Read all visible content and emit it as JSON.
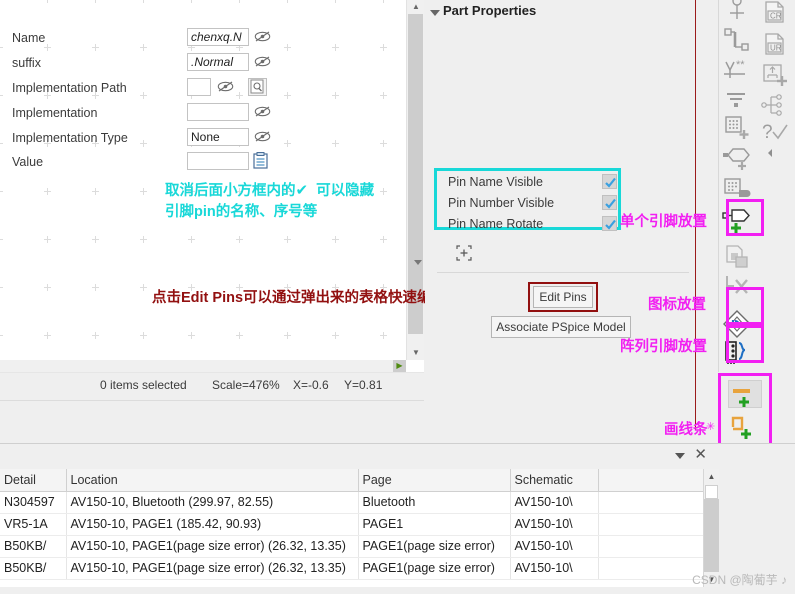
{
  "canvas": {
    "annotation_cyan_line1": "取消后面小方框内的",
    "annotation_cyan_check": "✔",
    "annotation_cyan_line1b": "可以隐藏",
    "annotation_cyan_line2": "引脚pin的名称、序号等",
    "annotation_darkred": "点击Edit Pins可以通过弹出来的表格快速编辑各引脚",
    "scroll_up_icon": "scroll-up-icon",
    "scroll_down_icon": "scroll-down-icon",
    "scroll_right_icon": "scroll-right-icon"
  },
  "statusbar": {
    "items_selected": "0 items selected",
    "scale": "Scale=476%",
    "x": "X=-0.6",
    "y": "Y=0.81"
  },
  "properties": {
    "title": "Part Properties",
    "rows": [
      {
        "label": "Name",
        "value": "chenxq.N",
        "placeholder": "",
        "italic": true,
        "has_eye": true,
        "has_browse": false,
        "has_clip": false,
        "type": "text"
      },
      {
        "label": "suffix",
        "value": ".Normal",
        "placeholder": "",
        "italic": true,
        "has_eye": true,
        "has_browse": false,
        "has_clip": false,
        "type": "text"
      },
      {
        "label": "Implementation Path",
        "value": "",
        "placeholder": "",
        "italic": false,
        "has_eye": true,
        "has_browse": true,
        "has_clip": false,
        "type": "text"
      },
      {
        "label": "Implementation",
        "value": "",
        "placeholder": "",
        "italic": false,
        "has_eye": true,
        "has_browse": false,
        "has_clip": false,
        "type": "text"
      },
      {
        "label": "Implementation Type",
        "value": "None",
        "placeholder": "",
        "italic": false,
        "has_eye": true,
        "has_browse": false,
        "has_clip": false,
        "type": "select"
      },
      {
        "label": "Value",
        "value": "",
        "placeholder": "",
        "italic": false,
        "has_eye": false,
        "has_browse": false,
        "has_clip": true,
        "type": "text"
      }
    ],
    "checkboxes": [
      {
        "label": "Pin Name Visible",
        "checked": true
      },
      {
        "label": "Pin Number Visible",
        "checked": true
      },
      {
        "label": "Pin Name Rotate",
        "checked": true
      }
    ],
    "edit_pins_label": "Edit Pins",
    "associate_pspice_label": "Associate PSpice Model",
    "expand_icon": "expand-marker-icon"
  },
  "annotations_magenta": {
    "single_pin": "单个引脚放置",
    "icon_place": "图标放置",
    "array_pin": "阵列引脚放置",
    "draw_line": "画线条"
  },
  "toolbar_main": [
    {
      "name": "place-net-alias-icon",
      "highlighted": false
    },
    {
      "name": "place-bus-entry-icon",
      "highlighted": false
    },
    {
      "name": "place-power-icon",
      "highlighted": false
    },
    {
      "name": "place-ground-icon",
      "highlighted": false
    },
    {
      "name": "place-hier-block-icon",
      "highlighted": false
    },
    {
      "name": "place-hier-port-icon",
      "highlighted": false
    },
    {
      "name": "place-hier-pin-icon",
      "highlighted": false
    },
    {
      "name": "place-pin-icon",
      "highlighted": true
    },
    {
      "name": "place-off-page-connector-icon",
      "highlighted": false
    },
    {
      "name": "place-no-connect-icon",
      "highlighted": false
    },
    {
      "name": "place-ieee-symbol-icon",
      "highlighted": true
    },
    {
      "name": "place-pin-array-icon",
      "highlighted": true
    }
  ],
  "toolbar_secondary": [
    {
      "name": "create-cr-doc-icon",
      "label": "CR"
    },
    {
      "name": "create-ur-doc-icon",
      "label": "UR"
    },
    {
      "name": "add-part-icon",
      "label": ""
    },
    {
      "name": "hierarchy-tree-icon",
      "label": ""
    },
    {
      "name": "help-check-icon",
      "label": "?"
    },
    {
      "name": "collapse-arrow-icon",
      "label": ""
    }
  ],
  "toolbar_draw": [
    {
      "name": "draw-line-icon"
    },
    {
      "name": "draw-polyline-icon"
    },
    {
      "name": "draw-rectangle-icon"
    },
    {
      "name": "draw-ellipse-icon"
    },
    {
      "name": "draw-arc-icon"
    },
    {
      "name": "draw-bezier-icon"
    }
  ],
  "bottom_panel": {
    "dropdown_icon": "panel-menu-caret-icon",
    "close_label": "✕",
    "columns": [
      "Detail",
      "Location",
      "Page",
      "Schematic",
      ""
    ],
    "rows": [
      {
        "detail": "N304597",
        "location": "AV150-10, Bluetooth  (299.97, 82.55)",
        "page": "Bluetooth",
        "schematic": "AV150-10\\",
        "extra": ""
      },
      {
        "detail": "VR5-1A",
        "location": "AV150-10, PAGE1  (185.42, 90.93)",
        "page": "PAGE1",
        "schematic": "AV150-10\\",
        "extra": ""
      },
      {
        "detail": "B50KB/",
        "location": "AV150-10, PAGE1(page size error)  (26.32, 13.35)",
        "page": "PAGE1(page size error)",
        "schematic": "AV150-10\\",
        "extra": ""
      },
      {
        "detail": "B50KB/",
        "location": "AV150-10, PAGE1(page size error)  (26.32, 13.35)",
        "page": "PAGE1(page size error)",
        "schematic": "AV150-10\\",
        "extra": ""
      }
    ],
    "scroll_up_icon": "scroll-up-icon",
    "scroll_down_icon": "scroll-down-icon"
  },
  "watermark": "CSDN @陶葡芋 ♪",
  "colors": {
    "cyan": "#18d8d8",
    "magenta": "#f21ff2",
    "darkred": "#921010",
    "orange": "#e8a33d",
    "green": "#22a022",
    "checkbox_blue": "#3aa0e0",
    "panel_bg": "#efefef"
  }
}
